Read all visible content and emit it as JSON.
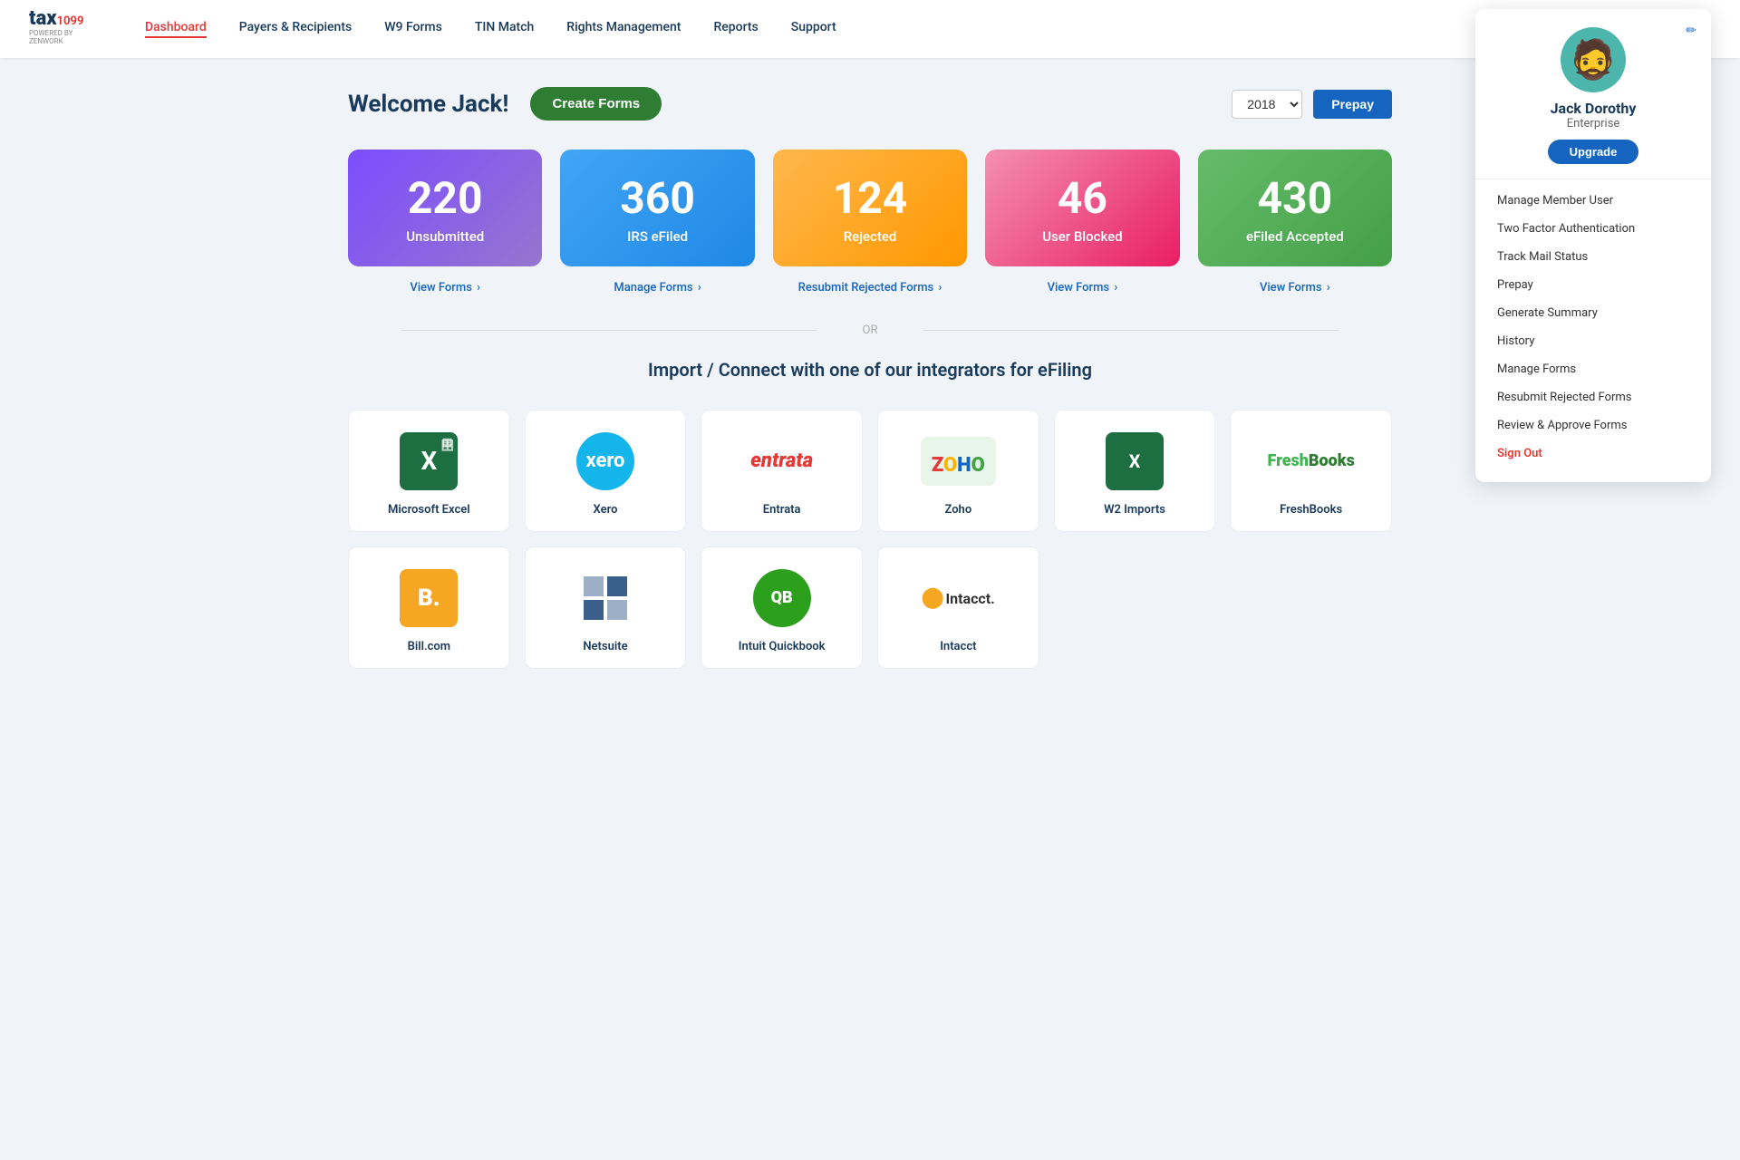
{
  "nav": {
    "logo_tax": "tax",
    "logo_1099": "1099",
    "logo_powered": "POWERED BY ZENWORK",
    "links": [
      {
        "id": "dashboard",
        "label": "Dashboard",
        "active": true
      },
      {
        "id": "payers",
        "label": "Payers & Recipients",
        "active": false
      },
      {
        "id": "w9forms",
        "label": "W9 Forms",
        "active": false
      },
      {
        "id": "tinmatch",
        "label": "TIN Match",
        "active": false
      },
      {
        "id": "rights",
        "label": "Rights Management",
        "active": false
      },
      {
        "id": "reports",
        "label": "Reports",
        "active": false
      },
      {
        "id": "support",
        "label": "Support",
        "active": false
      }
    ]
  },
  "header": {
    "welcome": "Welcome Jack!",
    "create_forms_label": "Create Forms",
    "year": "2018",
    "prepay_label": "Prepay"
  },
  "stats": [
    {
      "id": "unsubmitted",
      "number": "220",
      "label": "Unsubmitted",
      "link": "View Forms",
      "link_action": "view-forms",
      "card_class": "card-purple"
    },
    {
      "id": "irs-efiled",
      "number": "360",
      "label": "IRS eFiled",
      "link": "Manage Forms",
      "link_action": "manage-forms",
      "card_class": "card-blue"
    },
    {
      "id": "rejected",
      "number": "124",
      "label": "Rejected",
      "link": "Resubmit Rejected Forms",
      "link_action": "resubmit-rejected",
      "card_class": "card-orange"
    },
    {
      "id": "user-blocked",
      "number": "46",
      "label": "User Blocked",
      "link": "View Forms",
      "link_action": "view-forms-blocked",
      "card_class": "card-pink"
    },
    {
      "id": "efiled-accepted",
      "number": "430",
      "label": "eFiled Accepted",
      "link": "View Forms",
      "link_action": "view-forms-accepted",
      "card_class": "card-green"
    }
  ],
  "or_label": "OR",
  "import_title": "Import / Connect with one of our integrators for eFiling",
  "integrators_row1": [
    {
      "id": "microsoft-excel",
      "name": "Microsoft Excel",
      "icon_type": "excel"
    },
    {
      "id": "xero",
      "name": "Xero",
      "icon_type": "xero"
    },
    {
      "id": "entrata",
      "name": "Entrata",
      "icon_type": "entrata"
    },
    {
      "id": "zoho",
      "name": "Zoho",
      "icon_type": "zoho"
    },
    {
      "id": "w2imports",
      "name": "W2 Imports",
      "icon_type": "w2"
    },
    {
      "id": "freshbooks",
      "name": "FreshBooks",
      "icon_type": "freshbooks"
    }
  ],
  "integrators_row2": [
    {
      "id": "billcom",
      "name": "Bill.com",
      "icon_type": "billcom"
    },
    {
      "id": "netsuite",
      "name": "Netsuite",
      "icon_type": "netsuite"
    },
    {
      "id": "intuit-quickbook",
      "name": "Intuit Quickbook",
      "icon_type": "quickbooks"
    },
    {
      "id": "intacct",
      "name": "Intacct",
      "icon_type": "intacct"
    }
  ],
  "dropdown": {
    "avatar_emoji": "🧔",
    "name": "Jack Dorothy",
    "role": "Enterprise",
    "upgrade_label": "Upgrade",
    "edit_icon": "✏",
    "menu_items": [
      {
        "id": "manage-member-user",
        "label": "Manage Member User"
      },
      {
        "id": "two-factor-auth",
        "label": "Two Factor Authentication"
      },
      {
        "id": "track-mail-status",
        "label": "Track Mail Status"
      },
      {
        "id": "prepay",
        "label": "Prepay"
      },
      {
        "id": "generate-summary",
        "label": "Generate Summary"
      },
      {
        "id": "history",
        "label": "History"
      },
      {
        "id": "manage-forms",
        "label": "Manage Forms"
      },
      {
        "id": "resubmit-rejected",
        "label": "Resubmit Rejected Forms"
      },
      {
        "id": "review-approve",
        "label": "Review & Approve Forms"
      },
      {
        "id": "sign-out",
        "label": "Sign Out",
        "is_danger": true
      }
    ]
  }
}
